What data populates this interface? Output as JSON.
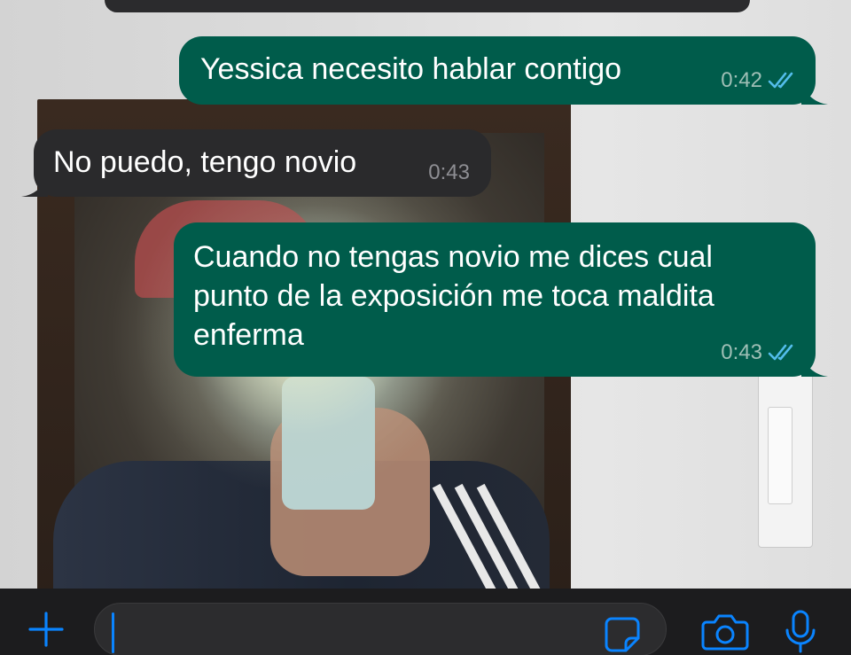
{
  "conversation": {
    "messages": [
      {
        "direction": "outgoing",
        "text": "Yessica necesito hablar contigo",
        "time": "0:42",
        "status": "read"
      },
      {
        "direction": "incoming",
        "text": "No puedo, tengo novio",
        "time": "0:43"
      },
      {
        "direction": "outgoing",
        "text": "Cuando no tengas novio me dices cual punto de la exposición me toca maldita enferma",
        "time": "0:43",
        "status": "read"
      }
    ]
  },
  "composer": {
    "placeholder": "",
    "value": ""
  },
  "icons": {
    "attach": "plus-icon",
    "sticker": "sticker-icon",
    "camera": "camera-icon",
    "microphone": "microphone-icon",
    "read_receipt": "double-check-icon"
  },
  "colors": {
    "outgoing_bubble": "#005c4b",
    "incoming_bubble": "#2a2a2c",
    "accent": "#0a84ff",
    "read_ticks": "#53bdeb",
    "background": "#1c1c1e"
  }
}
